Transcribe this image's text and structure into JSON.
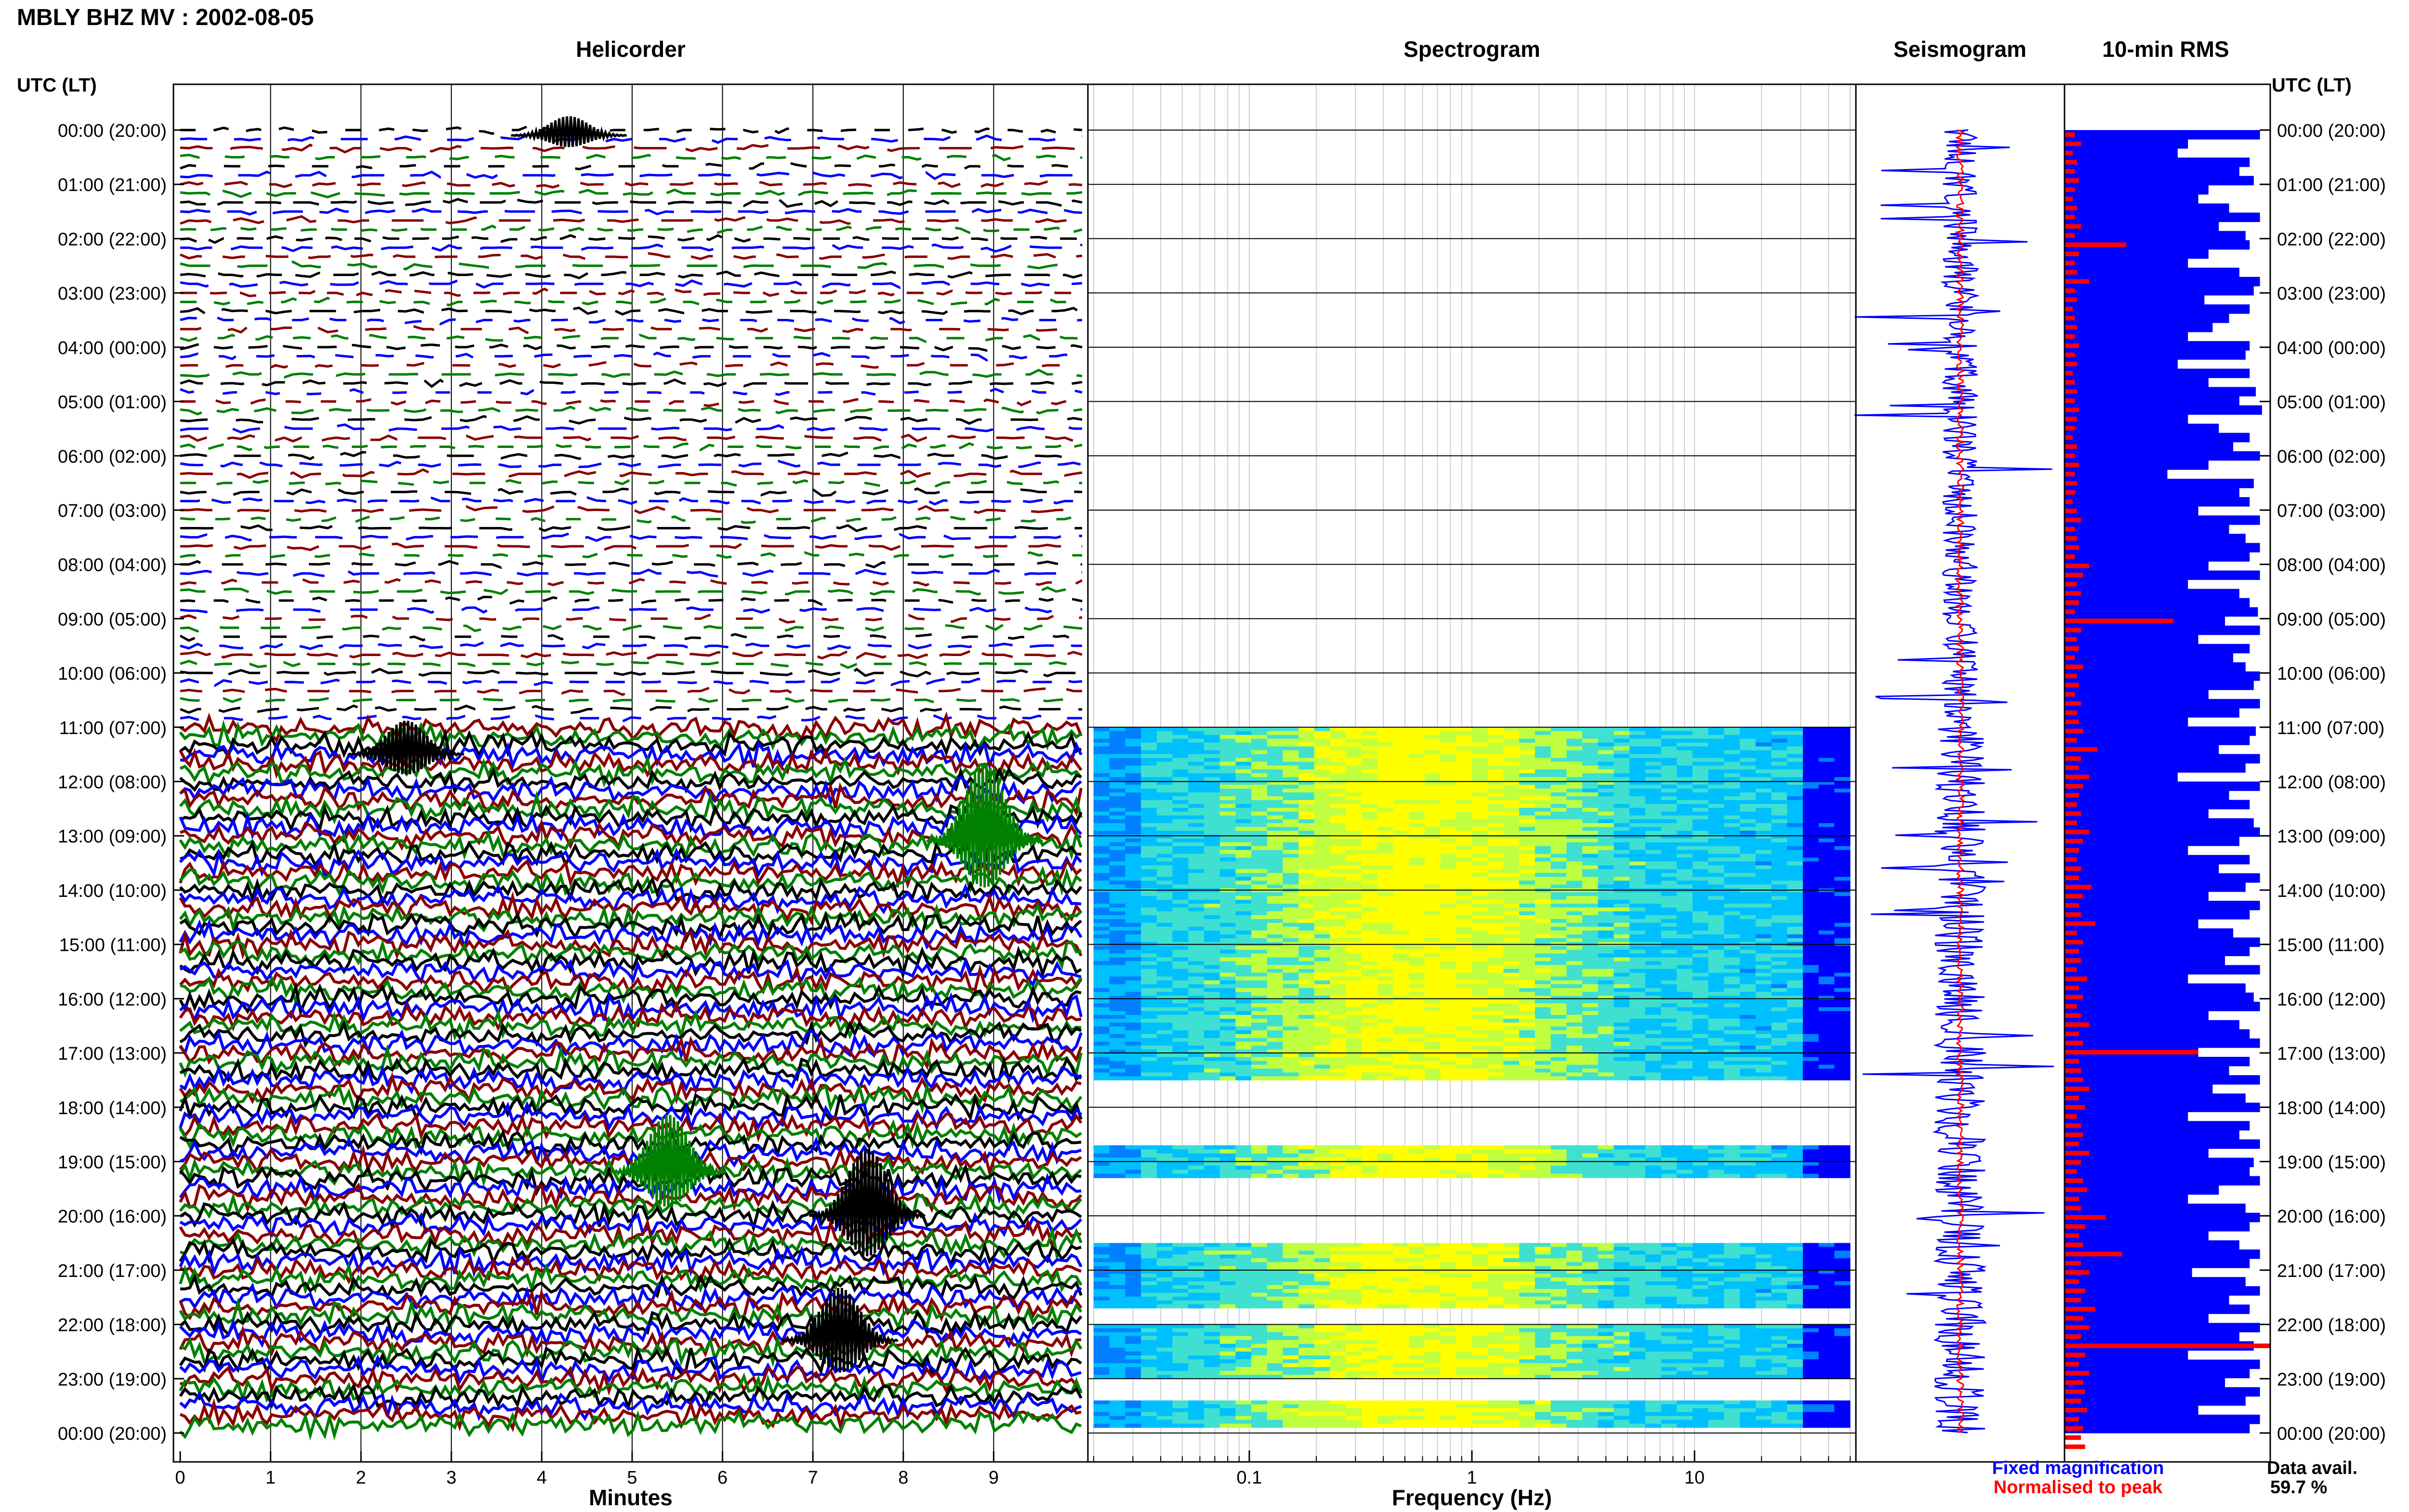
{
  "page_title": "MBLY BHZ MV : 2002-08-05",
  "left_axis_label": "UTC (LT)",
  "right_axis_label": "UTC (LT)",
  "panels": {
    "helicorder": "Helicorder",
    "spectrogram": "Spectrogram",
    "seismogram": "Seismogram",
    "rms": "10-min RMS"
  },
  "legend": {
    "fixed": "Fixed magnification",
    "normalised": "Normalised to peak",
    "fixed_color": "#0000ff",
    "normalised_color": "#ff0000"
  },
  "data_avail": {
    "label": "Data avail.",
    "value": "59.7 %"
  },
  "chart_data": [
    {
      "type": "line",
      "panel": "helicorder",
      "xlabel": "Minutes",
      "x_ticks": [
        "0",
        "1",
        "2",
        "3",
        "4",
        "5",
        "6",
        "7",
        "8",
        "9"
      ],
      "xlim": [
        0,
        10
      ],
      "time_ticks": [
        "00:00 (20:00)",
        "01:00 (21:00)",
        "02:00 (22:00)",
        "03:00 (23:00)",
        "04:00 (00:00)",
        "05:00 (01:00)",
        "06:00 (02:00)",
        "07:00 (03:00)",
        "08:00 (04:00)",
        "09:00 (05:00)",
        "10:00 (06:00)",
        "11:00 (07:00)",
        "12:00 (08:00)",
        "13:00 (09:00)",
        "14:00 (10:00)",
        "15:00 (11:00)",
        "16:00 (12:00)",
        "17:00 (13:00)",
        "18:00 (14:00)",
        "19:00 (15:00)",
        "20:00 (16:00)",
        "21:00 (17:00)",
        "22:00 (18:00)",
        "23:00 (19:00)",
        "00:00 (20:00)"
      ],
      "trace_colors": [
        "#000000",
        "#0000ff",
        "#8b0000",
        "#008000"
      ],
      "lines_per_hour": 6
    },
    {
      "type": "heatmap",
      "panel": "spectrogram",
      "xlabel": "Frequency (Hz)",
      "x_scale": "log",
      "x_ticks": [
        "0.1",
        "1",
        "10"
      ],
      "xlim": [
        0.02,
        50
      ],
      "data_segments_hours": [
        [
          11.0,
          17.5
        ],
        [
          18.7,
          19.3
        ],
        [
          20.5,
          21.7
        ],
        [
          22.0,
          23.0
        ],
        [
          23.4,
          23.9
        ]
      ],
      "colormap": [
        "#00008b",
        "#0000ff",
        "#0080ff",
        "#00c0ff",
        "#40e0d0",
        "#c0ff40",
        "#ffff00"
      ]
    },
    {
      "type": "line",
      "panel": "seismogram",
      "series": [
        {
          "name": "Fixed magnification",
          "color": "#0000ff"
        },
        {
          "name": "Normalised to peak",
          "color": "#ff0000"
        }
      ]
    },
    {
      "type": "bar",
      "panel": "rms",
      "interval_minutes": 10,
      "series": [
        {
          "name": "Fixed magnification",
          "color": "#0000ff",
          "values": [
            0.95,
            0.6,
            0.55,
            0.9,
            0.85,
            0.92,
            0.7,
            0.65,
            0.8,
            0.95,
            0.75,
            0.88,
            0.9,
            0.7,
            0.6,
            0.85,
            0.95,
            0.92,
            0.68,
            0.9,
            0.8,
            0.72,
            0.6,
            0.9,
            0.88,
            0.55,
            0.9,
            0.7,
            0.93,
            0.85,
            0.96,
            0.6,
            0.75,
            0.9,
            0.82,
            0.95,
            0.7,
            0.5,
            0.92,
            0.85,
            0.9,
            0.65,
            0.95,
            0.8,
            0.88,
            0.95,
            0.9,
            0.7,
            0.95,
            0.6,
            0.85,
            0.9,
            0.94,
            0.78,
            0.95,
            0.65,
            0.9,
            0.82,
            0.88,
            0.95,
            0.92,
            0.7,
            0.95,
            0.85,
            0.6,
            0.93,
            0.9,
            0.75,
            0.95,
            0.88,
            0.55,
            0.95,
            0.8,
            0.9,
            0.7,
            0.92,
            0.95,
            0.85,
            0.6,
            0.9,
            0.75,
            0.95,
            0.88,
            0.7,
            0.95,
            0.9,
            0.65,
            0.82,
            0.95,
            0.9,
            0.78,
            0.95,
            0.6,
            0.88,
            0.92,
            0.95,
            0.7,
            0.85,
            0.9,
            0.95,
            0.65,
            0.9,
            0.8,
            0.95,
            0.72,
            0.88,
            0.95,
            0.6,
            0.9,
            0.85,
            0.95,
            0.7,
            0.92,
            0.9,
            0.95,
            0.75,
            0.6,
            0.88,
            0.95,
            0.9,
            0.7,
            0.85,
            0.95,
            0.9,
            0.62,
            0.88,
            0.95,
            0.8,
            0.9,
            0.7,
            0.95,
            0.85,
            0.92,
            0.6,
            0.95,
            0.9,
            0.78,
            0.95,
            0.88,
            0.65,
            0.95,
            0.9
          ]
        },
        {
          "name": "Normalised to peak",
          "color": "#ff0000",
          "values": [
            0.05,
            0.08,
            0.04,
            0.06,
            0.05,
            0.07,
            0.05,
            0.04,
            0.06,
            0.05,
            0.08,
            0.05,
            0.3,
            0.07,
            0.05,
            0.06,
            0.12,
            0.05,
            0.06,
            0.04,
            0.05,
            0.06,
            0.05,
            0.07,
            0.05,
            0.06,
            0.04,
            0.05,
            0.06,
            0.05,
            0.07,
            0.06,
            0.05,
            0.04,
            0.06,
            0.05,
            0.07,
            0.05,
            0.06,
            0.05,
            0.04,
            0.06,
            0.08,
            0.05,
            0.06,
            0.07,
            0.05,
            0.12,
            0.09,
            0.06,
            0.08,
            0.07,
            0.05,
            0.53,
            0.08,
            0.06,
            0.07,
            0.05,
            0.09,
            0.06,
            0.07,
            0.05,
            0.08,
            0.06,
            0.07,
            0.09,
            0.06,
            0.16,
            0.08,
            0.07,
            0.12,
            0.09,
            0.07,
            0.06,
            0.08,
            0.06,
            0.12,
            0.09,
            0.07,
            0.06,
            0.08,
            0.07,
            0.13,
            0.09,
            0.07,
            0.08,
            0.15,
            0.06,
            0.09,
            0.07,
            0.08,
            0.06,
            0.11,
            0.07,
            0.09,
            0.06,
            0.08,
            0.12,
            0.07,
            0.09,
            0.65,
            0.07,
            0.08,
            0.09,
            0.12,
            0.07,
            0.1,
            0.06,
            0.08,
            0.09,
            0.07,
            0.12,
            0.08,
            0.06,
            0.09,
            0.11,
            0.07,
            0.08,
            0.2,
            0.1,
            0.07,
            0.09,
            0.28,
            0.08,
            0.12,
            0.07,
            0.1,
            0.08,
            0.15,
            0.09,
            0.12,
            0.08,
            1.0,
            0.1,
            0.07,
            0.12,
            0.09,
            0.1,
            0.08,
            0.11,
            0.07,
            0.09,
            0.08,
            0.1
          ]
        }
      ]
    }
  ]
}
